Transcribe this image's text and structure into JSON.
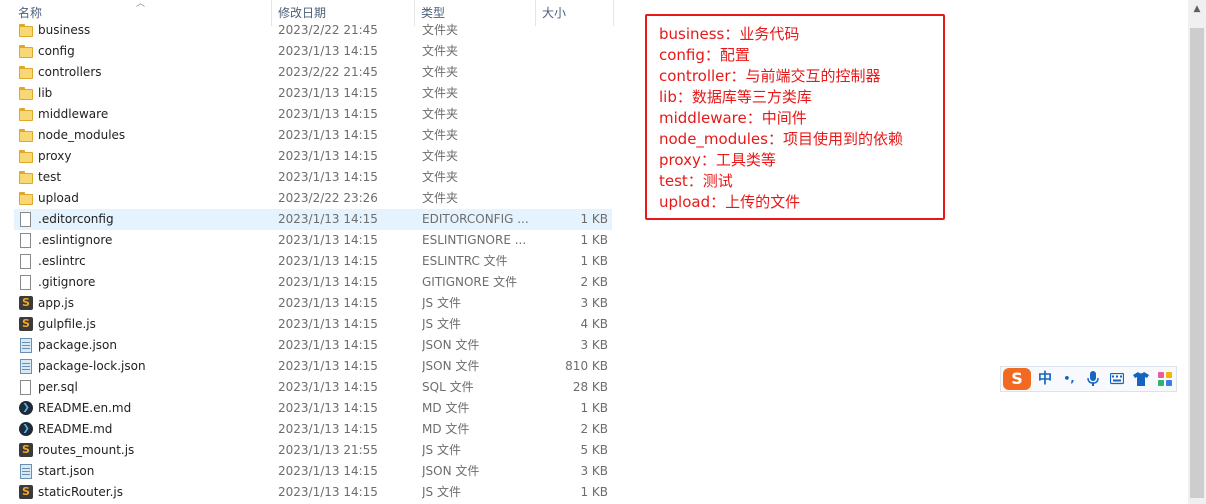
{
  "columns": {
    "name": "名称",
    "date": "修改日期",
    "type": "类型",
    "size": "大小"
  },
  "files": [
    {
      "name": "business",
      "date": "2023/2/22 21:45",
      "type": "文件夹",
      "size": "",
      "icon": "folder-icon"
    },
    {
      "name": "config",
      "date": "2023/1/13 14:15",
      "type": "文件夹",
      "size": "",
      "icon": "folder-icon"
    },
    {
      "name": "controllers",
      "date": "2023/2/22 21:45",
      "type": "文件夹",
      "size": "",
      "icon": "folder-icon"
    },
    {
      "name": "lib",
      "date": "2023/1/13 14:15",
      "type": "文件夹",
      "size": "",
      "icon": "folder-icon"
    },
    {
      "name": "middleware",
      "date": "2023/1/13 14:15",
      "type": "文件夹",
      "size": "",
      "icon": "folder-icon"
    },
    {
      "name": "node_modules",
      "date": "2023/1/13 14:15",
      "type": "文件夹",
      "size": "",
      "icon": "folder-icon"
    },
    {
      "name": "proxy",
      "date": "2023/1/13 14:15",
      "type": "文件夹",
      "size": "",
      "icon": "folder-icon"
    },
    {
      "name": "test",
      "date": "2023/1/13 14:15",
      "type": "文件夹",
      "size": "",
      "icon": "folder-icon"
    },
    {
      "name": "upload",
      "date": "2023/2/22 23:26",
      "type": "文件夹",
      "size": "",
      "icon": "folder-icon"
    },
    {
      "name": ".editorconfig",
      "date": "2023/1/13 14:15",
      "type": "EDITORCONFIG ...",
      "size": "1 KB",
      "icon": "file-icon"
    },
    {
      "name": ".eslintignore",
      "date": "2023/1/13 14:15",
      "type": "ESLINTIGNORE ...",
      "size": "1 KB",
      "icon": "file-icon"
    },
    {
      "name": ".eslintrc",
      "date": "2023/1/13 14:15",
      "type": "ESLINTRC 文件",
      "size": "1 KB",
      "icon": "file-icon"
    },
    {
      "name": ".gitignore",
      "date": "2023/1/13 14:15",
      "type": "GITIGNORE 文件",
      "size": "2 KB",
      "icon": "file-icon"
    },
    {
      "name": "app.js",
      "date": "2023/1/13 14:15",
      "type": "JS 文件",
      "size": "3 KB",
      "icon": "js-file-icon"
    },
    {
      "name": "gulpfile.js",
      "date": "2023/1/13 14:15",
      "type": "JS 文件",
      "size": "4 KB",
      "icon": "js-file-icon"
    },
    {
      "name": "package.json",
      "date": "2023/1/13 14:15",
      "type": "JSON 文件",
      "size": "3 KB",
      "icon": "json-file-icon"
    },
    {
      "name": "package-lock.json",
      "date": "2023/1/13 14:15",
      "type": "JSON 文件",
      "size": "810 KB",
      "icon": "json-file-icon"
    },
    {
      "name": "per.sql",
      "date": "2023/1/13 14:15",
      "type": "SQL 文件",
      "size": "28 KB",
      "icon": "file-icon"
    },
    {
      "name": "README.en.md",
      "date": "2023/1/13 14:15",
      "type": "MD 文件",
      "size": "1 KB",
      "icon": "md-file-icon"
    },
    {
      "name": "README.md",
      "date": "2023/1/13 14:15",
      "type": "MD 文件",
      "size": "2 KB",
      "icon": "md-file-icon"
    },
    {
      "name": "routes_mount.js",
      "date": "2023/1/13 21:55",
      "type": "JS 文件",
      "size": "5 KB",
      "icon": "js-file-icon"
    },
    {
      "name": "start.json",
      "date": "2023/1/13 14:15",
      "type": "JSON 文件",
      "size": "3 KB",
      "icon": "json-file-icon"
    },
    {
      "name": "staticRouter.js",
      "date": "2023/1/13 14:15",
      "type": "JS 文件",
      "size": "1 KB",
      "icon": "js-file-icon"
    }
  ],
  "selected_index": 9,
  "annotation": {
    "color": "#e81818",
    "lines": [
      "business：业务代码",
      "config：配置",
      "controller：与前端交互的控制器",
      "lib：数据库等三方类库",
      "middleware：中间件",
      "node_modules：项目使用到的依赖",
      "proxy：工具类等",
      "test：测试",
      "upload：上传的文件"
    ]
  },
  "ime_toolbar": {
    "logo": "S",
    "mode": "中",
    "punct": "•,",
    "icons": [
      "sogou-logo-icon",
      "chinese-mode-icon",
      "punctuation-icon",
      "microphone-icon",
      "keyboard-icon",
      "skin-icon",
      "toolbox-icon"
    ]
  }
}
